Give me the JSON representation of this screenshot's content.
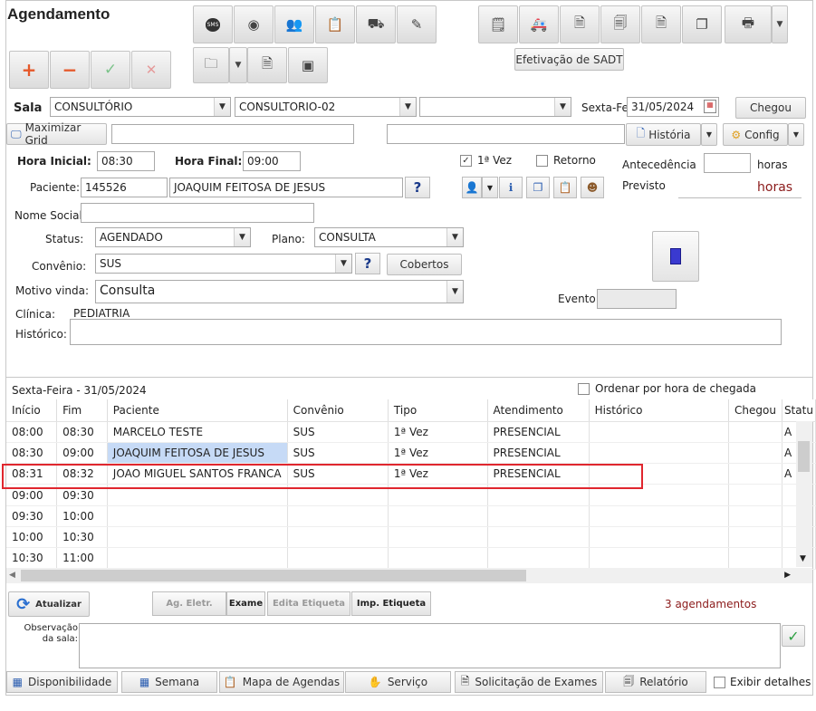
{
  "window": {
    "title": "Agendamento"
  },
  "toolbar": {
    "add_label": "+",
    "remove_label": "−",
    "confirm_label": "✓",
    "cancel_label": "✕",
    "sadt_label": "Efetivação de SADT"
  },
  "header": {
    "sala_label": "Sala",
    "sala_value": "CONSULTÓRIO",
    "consultorio_value": "CONSULTORIO-02",
    "third_select_value": "",
    "day_label": "Sexta-Fei",
    "date_value": "31/05/2024",
    "chegou_label": "Chegou",
    "maximize_label": "Maximizar Grid",
    "historia_label": "História",
    "config_label": "Config"
  },
  "form": {
    "hora_inicial_label": "Hora Inicial:",
    "hora_inicial_value": "08:30",
    "hora_final_label": "Hora Final:",
    "hora_final_value": "09:00",
    "primeira_vez_label": "1ª Vez",
    "primeira_vez_checked": true,
    "retorno_label": "Retorno",
    "antecedencia_label": "Antecedência",
    "antecedencia_value": "",
    "horas_label": "horas",
    "previsto_label": "Previsto",
    "previsto_value": "horas",
    "paciente_label": "Paciente:",
    "paciente_id": "145526",
    "paciente_nome": "JOAQUIM  FEITOSA DE JESUS",
    "nome_social_label": "Nome Social:",
    "nome_social_value": "",
    "status_label": "Status:",
    "status_value": "AGENDADO",
    "plano_label": "Plano:",
    "plano_value": "CONSULTA",
    "convenio_label": "Convênio:",
    "convenio_value": "SUS",
    "cobertos_label": "Cobertos",
    "motivo_label": "Motivo vinda:",
    "motivo_value": "Consulta",
    "evento_label": "Evento:",
    "evento_value": "",
    "clinica_label": "Clínica:",
    "clinica_value": "PEDIATRIA",
    "historico_label": "Histórico:",
    "historico_value": ""
  },
  "schedule": {
    "date_title": "Sexta-Feira - 31/05/2024",
    "ordenar_label": "Ordenar por hora de chegada",
    "columns": [
      "Início",
      "Fim",
      "Paciente",
      "Convênio",
      "Tipo",
      "Atendimento",
      "Histórico",
      "Chegou",
      "Statu"
    ],
    "rows": [
      [
        "08:00",
        "08:30",
        "MARCELO TESTE",
        "SUS",
        "1ª Vez",
        "PRESENCIAL",
        "",
        "",
        "A"
      ],
      [
        "08:30",
        "09:00",
        "JOAQUIM FEITOSA DE JESUS",
        "SUS",
        "1ª Vez",
        "PRESENCIAL",
        "",
        "",
        "A"
      ],
      [
        "08:31",
        "08:32",
        "JOAO MIGUEL SANTOS FRANCA",
        "SUS",
        "1ª Vez",
        "PRESENCIAL",
        "",
        "",
        "A"
      ],
      [
        "09:00",
        "09:30",
        "",
        "",
        "",
        "",
        "",
        "",
        ""
      ],
      [
        "09:30",
        "10:00",
        "",
        "",
        "",
        "",
        "",
        "",
        ""
      ],
      [
        "10:00",
        "10:30",
        "",
        "",
        "",
        "",
        "",
        "",
        ""
      ],
      [
        "10:30",
        "11:00",
        "",
        "",
        "",
        "",
        "",
        "",
        ""
      ]
    ],
    "count_text": "3 agendamentos"
  },
  "actions": {
    "atualizar_label": "Atualizar",
    "ag_eletr_label": "Ag. Eletr.",
    "exame_label": "Exame",
    "edita_etiqueta_label": "Edita Etiqueta",
    "imp_etiqueta_label": "Imp. Etiqueta",
    "observacao_label": "Observação da sala:",
    "observacao_value": ""
  },
  "bottom": {
    "disponibilidade": "Disponibilidade",
    "semana": "Semana",
    "mapa": "Mapa de Agendas",
    "servico": "Serviço",
    "solicitacao": "Solicitação de Exames",
    "relatorio": "Relatório",
    "exibir_detalhes": "Exibir detalhes"
  },
  "colors": {
    "highlight_border": "#e0262e",
    "selected_cell": "#c6daf6",
    "count_text": "#8b1a1a"
  }
}
